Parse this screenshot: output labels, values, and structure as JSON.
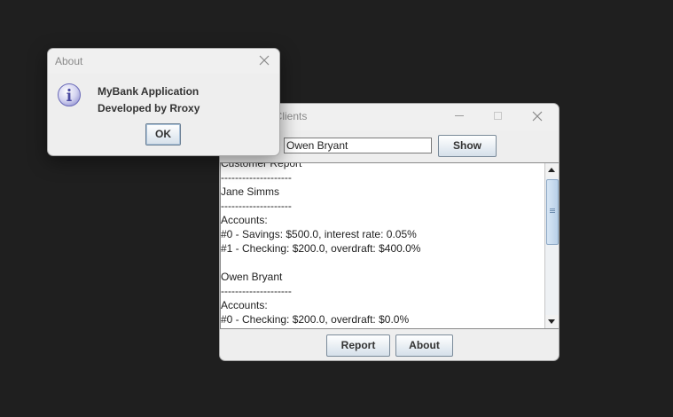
{
  "main_window": {
    "title": "MyBank Clients",
    "name_input_value": "Owen Bryant",
    "show_label": "Show",
    "report_label": "Report",
    "about_label": "About",
    "report_lines": [
      "Customer Report",
      "--------------------",
      "Jane Simms",
      "--------------------",
      "Accounts:",
      "#0 - Savings: $500.0, interest rate: 0.05%",
      "#1 - Checking: $200.0, overdraft: $400.0%",
      "",
      "Owen Bryant",
      "--------------------",
      "Accounts:",
      "#0 - Checking: $200.0, overdraft: $0.0%"
    ]
  },
  "about_dialog": {
    "title": "About",
    "line1": "MyBank Application",
    "line2": "Developed by Rroxy",
    "ok_label": "OK",
    "icon": "info-icon"
  }
}
